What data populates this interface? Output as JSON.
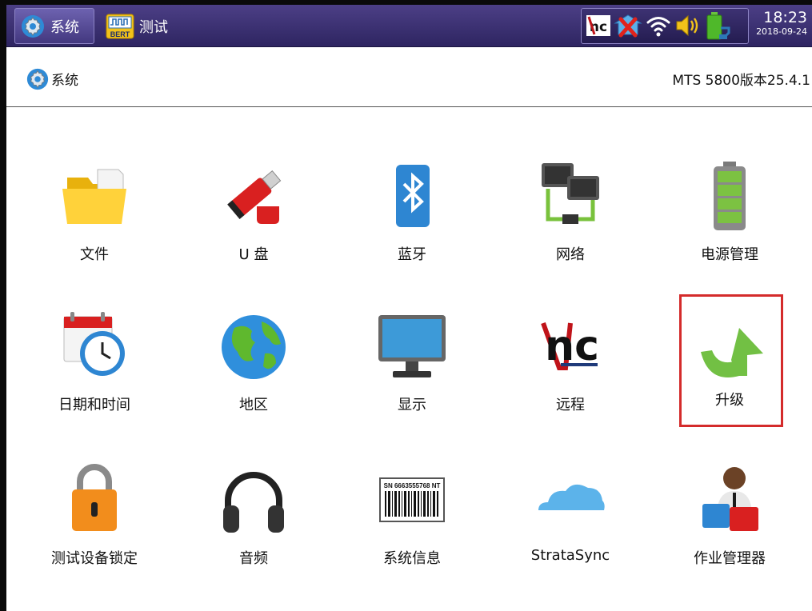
{
  "topbar": {
    "tab_system_label": "系统",
    "tab_test_label": "测试",
    "bert_badge": "BERT",
    "status_icons": [
      "vnc-icon",
      "network-disconnected-icon",
      "wifi-icon",
      "speaker-icon",
      "battery-charging-icon"
    ],
    "time": "18:23",
    "date": "2018-09-24"
  },
  "header": {
    "title": "系统",
    "version": "MTS 5800版本25.4.1"
  },
  "tiles": [
    {
      "label": "文件",
      "icon": "folder-icon"
    },
    {
      "label": "U 盘",
      "icon": "usb-drive-icon"
    },
    {
      "label": "蓝牙",
      "icon": "bluetooth-icon"
    },
    {
      "label": "网络",
      "icon": "network-icon"
    },
    {
      "label": "电源管理",
      "icon": "battery-icon"
    },
    {
      "label": "日期和时间",
      "icon": "calendar-clock-icon"
    },
    {
      "label": "地区",
      "icon": "globe-icon"
    },
    {
      "label": "显示",
      "icon": "monitor-icon"
    },
    {
      "label": "远程",
      "icon": "vnc-remote-icon"
    },
    {
      "label": "升级",
      "icon": "upgrade-arrow-icon",
      "selected": true
    },
    {
      "label": "测试设备锁定",
      "icon": "padlock-icon"
    },
    {
      "label": "音频",
      "icon": "headphones-icon"
    },
    {
      "label": "系统信息",
      "icon": "barcode-icon",
      "icon_text": "SN 6663555768 NT"
    },
    {
      "label": "StrataSync",
      "icon": "cloud-icon"
    },
    {
      "label": "作业管理器",
      "icon": "job-manager-icon"
    }
  ]
}
